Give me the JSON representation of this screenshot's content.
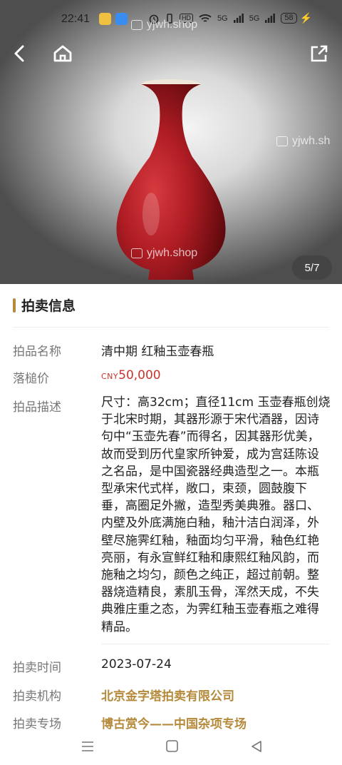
{
  "status_bar": {
    "time": "22:41",
    "chip_hd": "HD",
    "signal_1": "5G",
    "signal_2": "5G",
    "battery": "58",
    "app_icon_colors": [
      "#f0c040",
      "#3a8df0"
    ]
  },
  "gallery": {
    "counter": "5/7",
    "watermark": "yjwh.shop",
    "watermark_partial": "yjwh.sh",
    "vase_color": "#b01d24"
  },
  "header": {
    "back_icon": "back-arrow-icon",
    "home_icon": "home-icon",
    "share_icon": "share-icon"
  },
  "auction_info": {
    "section_title": "拍卖信息",
    "name_label": "拍品名称",
    "name_value": "清中期 红釉玉壶春瓶",
    "price_label": "落槌价",
    "price_currency": "CNY",
    "price_value": "50,000",
    "desc_label": "拍品描述",
    "desc_value": "尺寸：高32cm；直径11cm 玉壶春瓶创烧于北宋时期，其器形源于宋代酒器，因诗句中“玉壶先春”而得名，因其器形优美，故而受到历代皇家所钟爱，成为宫廷陈设之名品，是中国瓷器经典造型之一。本瓶型承宋代式样，敞口，束颈，圆鼓腹下垂，高圈足外撇，造型秀美典雅。器口、内壁及外底满施白釉，釉汁洁白润泽，外壁尽施霁红釉，釉面均匀平滑，釉色红艳亮丽，有永宣鲜红釉和康熙红釉风韵，而施釉之均匀，颜色之纯正，超过前朝。整器烧造精良，素肌玉骨，浑然天成，不失典雅庄重之态，为霁红釉玉壶春瓶之难得精品。",
    "time_label": "拍卖时间",
    "time_value": "2023-07-24",
    "org_label": "拍卖机构",
    "org_value": "北京金字塔拍卖有限公司",
    "session_label": "拍卖专场",
    "session_value": "博古赏今——中国杂项专场"
  },
  "colors": {
    "accent_gold": "#b58a3b",
    "price_red": "#c8342c"
  }
}
